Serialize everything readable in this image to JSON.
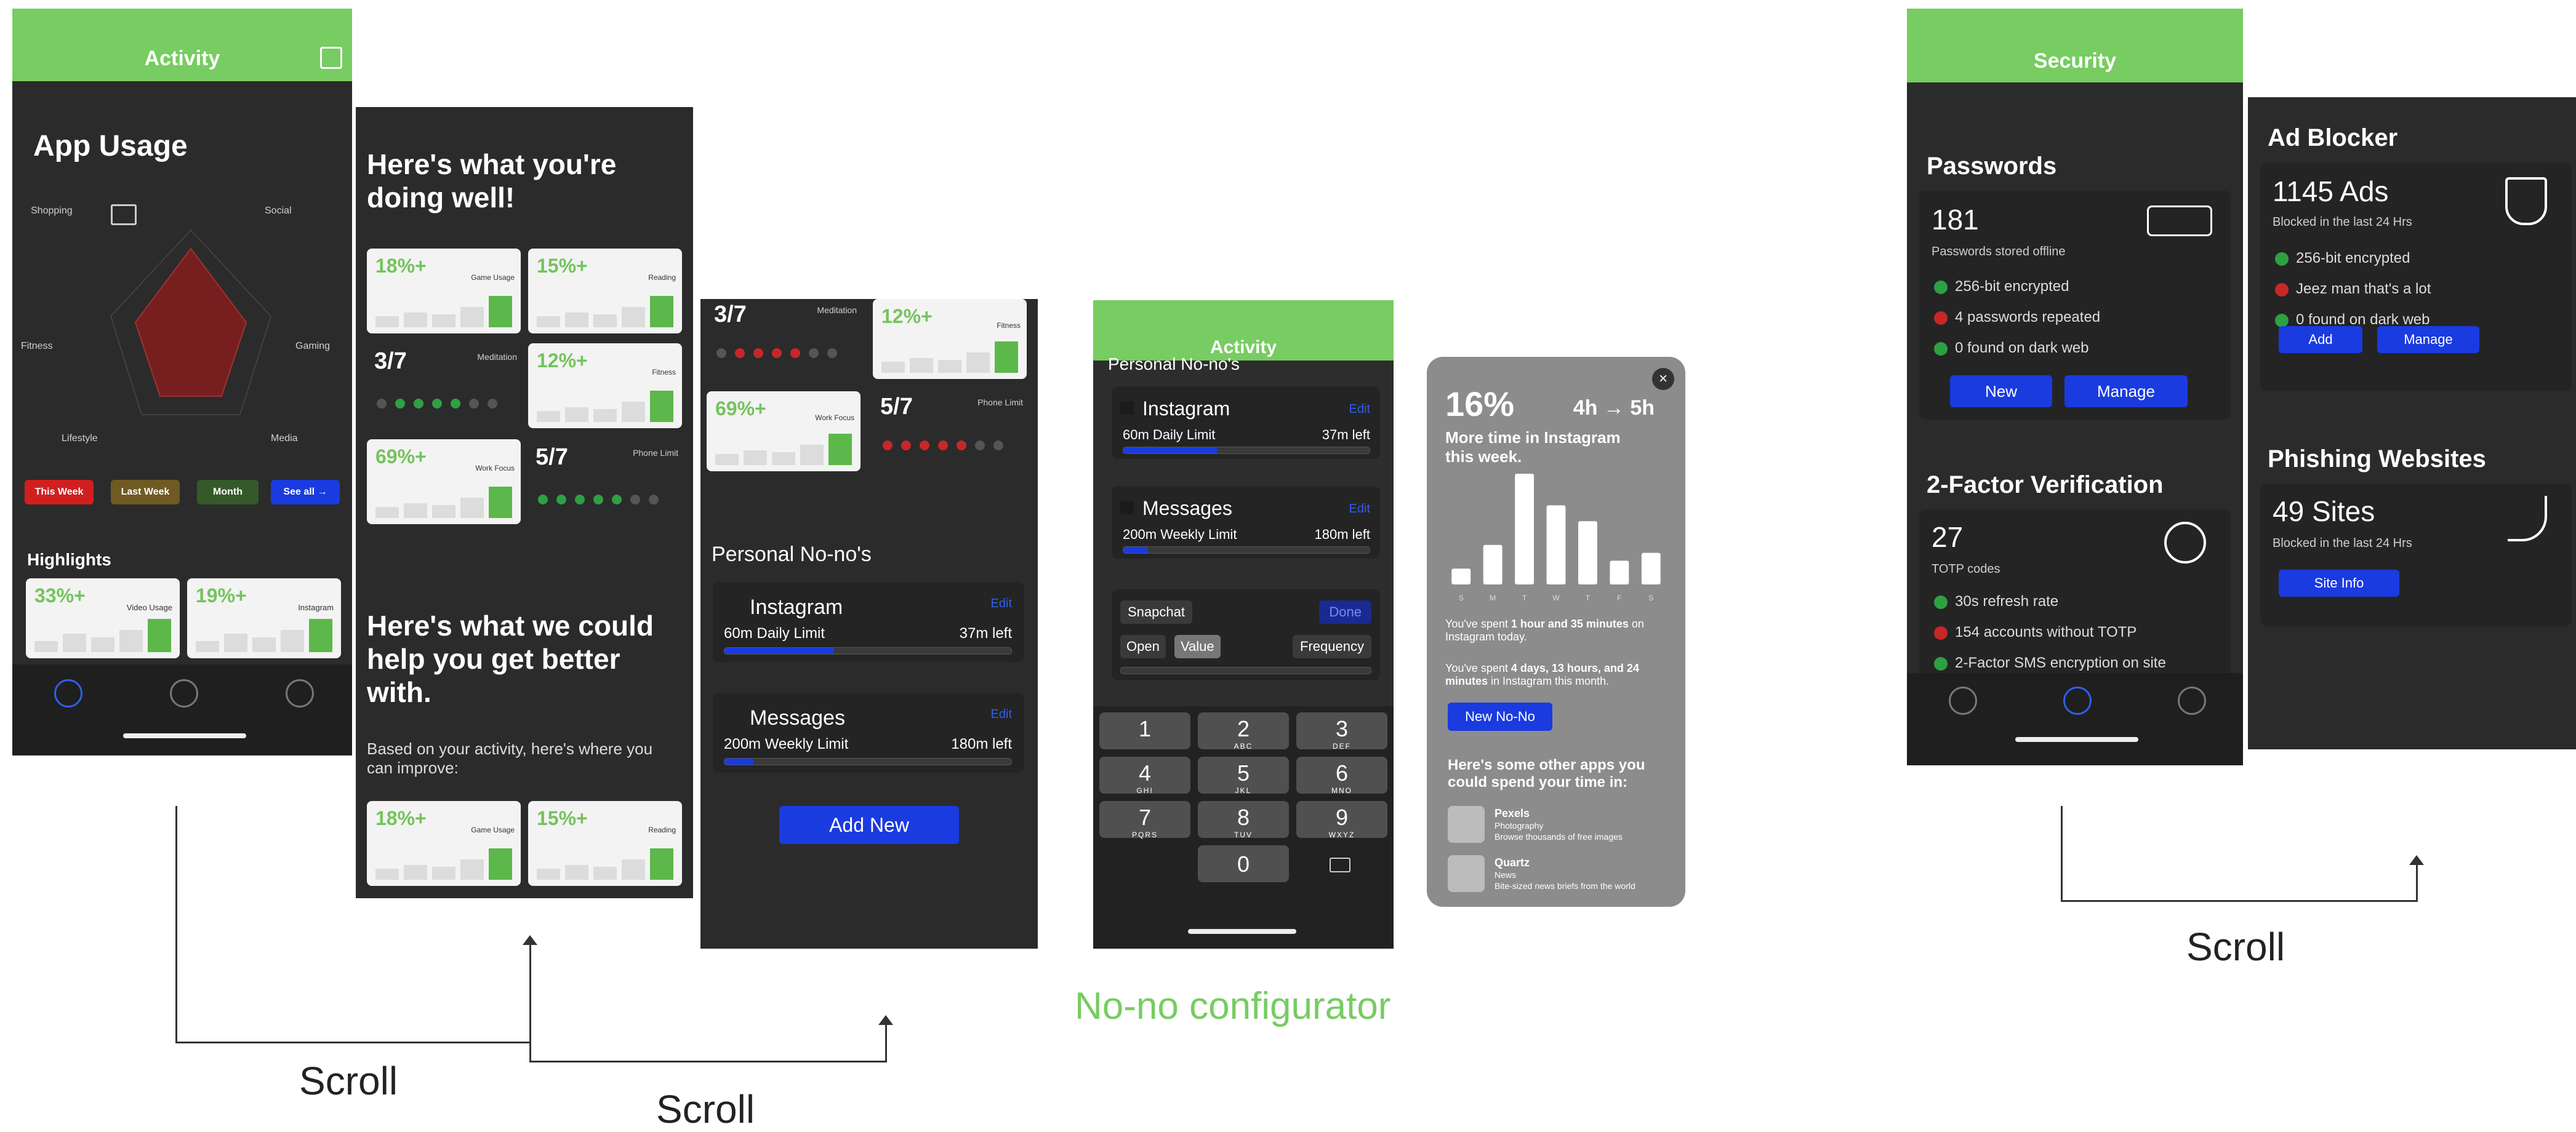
{
  "screen1": {
    "title": "Activity",
    "heading": "App Usage",
    "radar_labels": [
      "Shopping",
      "Social",
      "Fitness",
      "Gaming",
      "Lifestyle",
      "Media"
    ],
    "pills": [
      "This Week",
      "Last Week",
      "Month",
      "See all →"
    ],
    "highlights_title": "Highlights",
    "highlights": [
      {
        "pct": "33%+",
        "label": "Video Usage"
      },
      {
        "pct": "19%+",
        "label": "Instagram"
      }
    ]
  },
  "screen2": {
    "heading1": "Here's what you're doing well!",
    "cards": [
      {
        "pct": "18%+",
        "label": "Game Usage"
      },
      {
        "pct": "15%+",
        "label": "Reading"
      },
      {
        "big": "3/7",
        "label": "Meditation"
      },
      {
        "pct": "12%+",
        "label": "Fitness"
      },
      {
        "pct": "69%+",
        "label": "Work Focus"
      },
      {
        "big": "5/7",
        "label": "Phone Limit"
      }
    ],
    "heading2": "Here's what we could help you get better with.",
    "body": "Based on your activity, here's where you can improve:",
    "bottom_cards": [
      {
        "pct": "18%+",
        "label": "Game Usage"
      },
      {
        "pct": "15%+",
        "label": "Reading"
      }
    ]
  },
  "screen3": {
    "top_cards": [
      {
        "big": "3/7",
        "label": "Meditation"
      },
      {
        "pct": "12%+",
        "label": "Fitness"
      },
      {
        "pct": "69%+",
        "label": "Work Focus"
      },
      {
        "big": "5/7",
        "label": "Phone Limit"
      }
    ],
    "section_title": "Personal No-no's",
    "items": [
      {
        "name": "Instagram",
        "limit": "60m Daily Limit",
        "left": "37m left",
        "edit": "Edit",
        "progress": 0.38
      },
      {
        "name": "Messages",
        "limit": "200m Weekly Limit",
        "left": "180m left",
        "edit": "Edit",
        "progress": 0.1
      }
    ],
    "add_button": "Add New"
  },
  "screen4": {
    "title": "Activity",
    "section_title": "Personal No-no's",
    "items": [
      {
        "name": "Instagram",
        "limit": "60m Daily Limit",
        "left": "37m left",
        "edit": "Edit",
        "progress": 0.38
      },
      {
        "name": "Messages",
        "limit": "200m Weekly Limit",
        "left": "180m left",
        "edit": "Edit",
        "progress": 0.1
      }
    ],
    "editor": {
      "app": "Snapchat",
      "done": "Done",
      "open": "Open",
      "value": "Value",
      "frequency": "Frequency"
    },
    "keys": [
      {
        "n": "1",
        "s": ""
      },
      {
        "n": "2",
        "s": "ABC"
      },
      {
        "n": "3",
        "s": "DEF"
      },
      {
        "n": "4",
        "s": "GHI"
      },
      {
        "n": "5",
        "s": "JKL"
      },
      {
        "n": "6",
        "s": "MNO"
      },
      {
        "n": "7",
        "s": "PQRS"
      },
      {
        "n": "8",
        "s": "TUV"
      },
      {
        "n": "9",
        "s": "WXYZ"
      },
      {
        "n": "0",
        "s": ""
      }
    ],
    "caption": "No-no configurator"
  },
  "popup": {
    "pct": "16%",
    "range": "4h → 5h",
    "subtitle": "More time in Instagram this week.",
    "bar_values": [
      2,
      5,
      14,
      10,
      8,
      3,
      4
    ],
    "days": [
      "S",
      "M",
      "T",
      "W",
      "T",
      "F",
      "S"
    ],
    "line1_a": "You've spent ",
    "line1_b": "1 hour and 35 minutes",
    "line1_c": " on Instagram today.",
    "line2_a": "You've spent ",
    "line2_b": "4 days, 13 hours, and 24 minutes",
    "line2_c": " in Instagram this month.",
    "button": "New No-No",
    "other_title": "Here's some other apps you could spend your time in:",
    "apps": [
      {
        "name": "Pexels",
        "category": "Photography",
        "desc": "Browse thousands of free images"
      },
      {
        "name": "Quartz",
        "category": "News",
        "desc": "Bite-sized news briefs from the world"
      }
    ]
  },
  "screen5": {
    "title": "Security",
    "passwords_title": "Passwords",
    "passwords_count": "181",
    "passwords_sub": "Passwords stored offline",
    "passwords_checks": [
      {
        "text": "256-bit encrypted",
        "status": "ok"
      },
      {
        "text": "4 passwords repeated",
        "status": "bad"
      },
      {
        "text": "0 found on dark web",
        "status": "ok"
      }
    ],
    "new_btn": "New",
    "manage_btn": "Manage",
    "twofa_title": "2-Factor Verification",
    "twofa_count": "27",
    "twofa_sub": "TOTP codes",
    "twofa_checks": [
      {
        "text": "30s refresh rate",
        "status": "ok"
      },
      {
        "text": "154 accounts without TOTP",
        "status": "bad"
      },
      {
        "text": "2-Factor SMS encryption on site",
        "status": "ok"
      }
    ]
  },
  "screen6": {
    "adblock_title": "Ad Blocker",
    "adblock_count": "1145 Ads",
    "adblock_sub": "Blocked in the last 24 Hrs",
    "adblock_checks": [
      {
        "text": "256-bit encrypted",
        "status": "ok"
      },
      {
        "text": "Jeez man that's a lot",
        "status": "bad"
      },
      {
        "text": "0 found on dark web",
        "status": "ok"
      }
    ],
    "add_btn": "Add",
    "manage_btn": "Manage",
    "phish_title": "Phishing Websites",
    "phish_count": "49 Sites",
    "phish_sub": "Blocked in the last 24 Hrs",
    "phish_btn": "Site Info"
  },
  "annotations": {
    "scroll1": "Scroll",
    "scroll2": "Scroll",
    "scroll3": "Scroll"
  },
  "colors": {
    "accent_green": "#77cc62",
    "blue": "#1a3be0",
    "red": "#c62828",
    "green": "#2ea043"
  }
}
